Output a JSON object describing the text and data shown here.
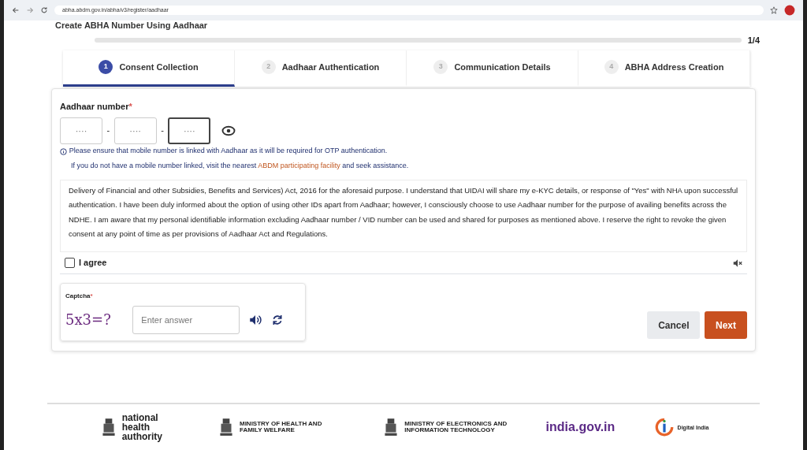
{
  "browser": {
    "url": "abha.abdm.gov.in/abha/v3/register/aadhaar"
  },
  "heading": "Create ABHA Number Using Aadhaar",
  "progress": {
    "reading": "1/4"
  },
  "steps": [
    {
      "number": "1",
      "label": "Consent Collection",
      "selected": true
    },
    {
      "number": "2",
      "label": "Aadhaar Authentication",
      "selected": false
    },
    {
      "number": "3",
      "label": "Communication Details",
      "selected": false
    },
    {
      "number": "4",
      "label": "ABHA Address Creation",
      "selected": false
    }
  ],
  "aadhaar": {
    "label": "Aadhaar number",
    "required": "*",
    "fields": [
      {
        "placeholder": "····",
        "focused": false
      },
      {
        "placeholder": "····",
        "focused": false
      },
      {
        "placeholder": "····",
        "focused": true
      }
    ],
    "separator": "-"
  },
  "notice": "Please ensure that mobile number is linked with Aadhaar as it will be required for OTP authentication.",
  "assist": {
    "before": "If you do not have a mobile number linked, visit the nearest ",
    "link": "ABDM participating facility",
    "after": " and seek assistance."
  },
  "consent_text": "Delivery of Financial and other Subsidies, Benefits and Services) Act, 2016 for the aforesaid purpose. I understand that UIDAI will share my e-KYC details, or response of \"Yes\" with NHA upon successful authentication. I have been duly informed about the option of using other IDs apart from Aadhaar; however, I consciously choose to use Aadhaar number for the purpose of availing benefits across the NDHE. I am aware that my personal identifiable information excluding Aadhaar number / VID number can be used and shared for purposes as mentioned above. I reserve the right to revoke the given consent at any point of time as per provisions of Aadhaar Act and Regulations.",
  "agree": {
    "label": "I agree",
    "checked": false
  },
  "captcha": {
    "label": "Captcha",
    "required": "*",
    "expression": "5x3=?",
    "placeholder": "Enter answer"
  },
  "buttons": [
    {
      "kind": "secondary",
      "label": "Cancel"
    },
    {
      "kind": "primary",
      "label": "Next"
    }
  ],
  "footer_logos": [
    {
      "kind": "nha",
      "text": "national health authority"
    },
    {
      "kind": "ministry",
      "text": "MINISTRY OF HEALTH AND FAMILY WELFARE"
    },
    {
      "kind": "ministry",
      "text": "MINISTRY OF ELECTRONICS AND INFORMATION TECHNOLOGY"
    },
    {
      "kind": "indiagov",
      "text": "india.gov.in"
    },
    {
      "kind": "digital",
      "text": "Digital India"
    }
  ]
}
